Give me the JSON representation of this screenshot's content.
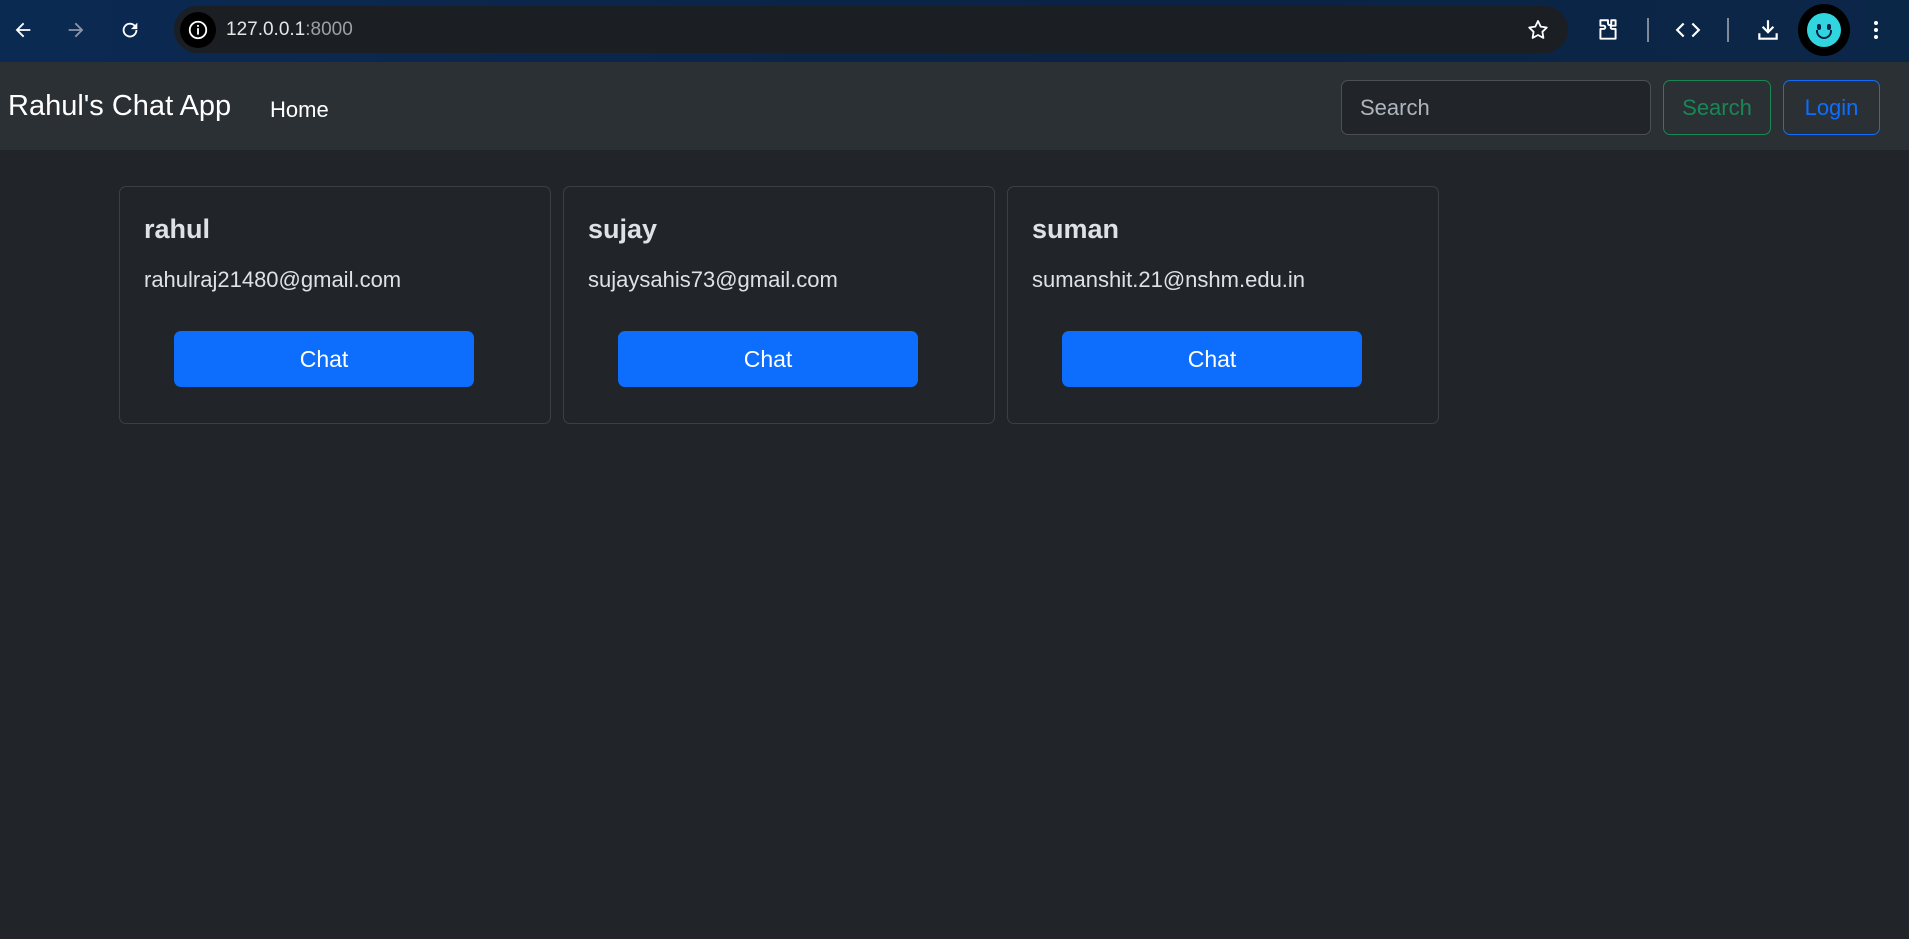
{
  "browser": {
    "url_host": "127.0.0.1",
    "url_port": ":8000"
  },
  "navbar": {
    "brand": "Rahul's Chat App",
    "home_link": "Home",
    "search_placeholder": "Search",
    "search_button": "Search",
    "login_button": "Login"
  },
  "users": [
    {
      "name": "rahul",
      "email": "rahulraj21480@gmail.com",
      "button": "Chat"
    },
    {
      "name": "sujay",
      "email": "sujaysahis73@gmail.com",
      "button": "Chat"
    },
    {
      "name": "suman",
      "email": "sumanshit.21@nshm.edu.in",
      "button": "Chat"
    }
  ],
  "colors": {
    "page_bg": "#212529",
    "navbar_bg": "#2b3035",
    "primary": "#0d6efd",
    "success": "#198754"
  },
  "icons": [
    "back-arrow-icon",
    "forward-arrow-icon",
    "reload-icon",
    "site-info-icon",
    "bookmark-star-icon",
    "extensions-icon",
    "devtools-code-icon",
    "download-icon",
    "profile-avatar-icon",
    "menu-kebab-icon"
  ]
}
